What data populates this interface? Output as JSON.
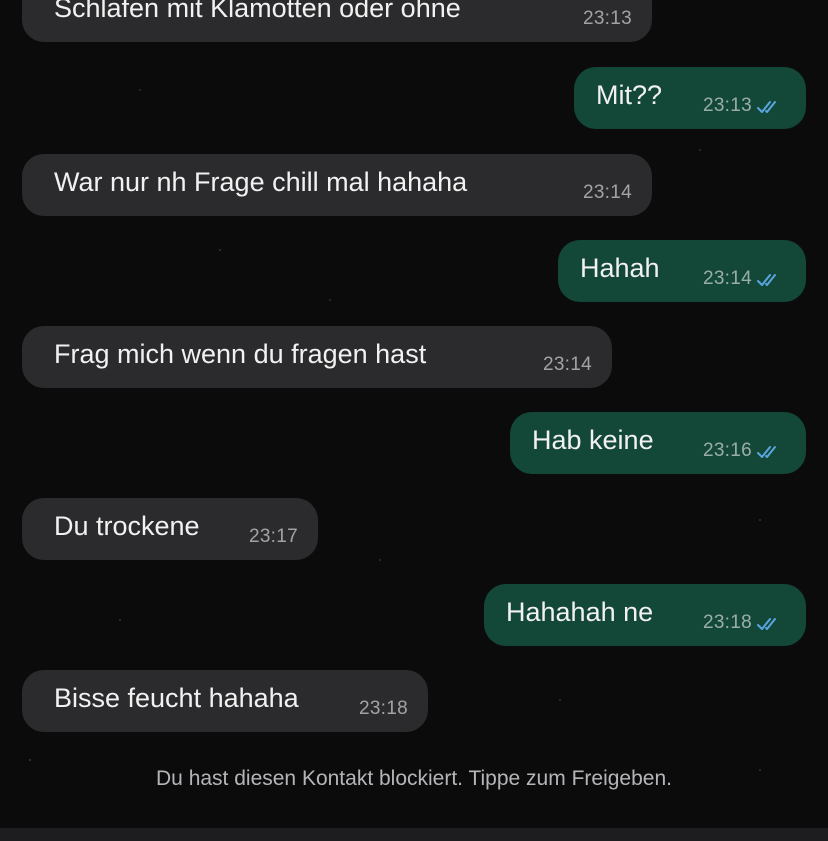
{
  "messages": [
    {
      "direction": "in",
      "text": "Schlafen mit Klamotten oder ohne",
      "time": "23:13"
    },
    {
      "direction": "out",
      "text": "Mit??",
      "time": "23:13",
      "status": "read"
    },
    {
      "direction": "in",
      "text": "War nur nh Frage chill mal hahaha",
      "time": "23:14"
    },
    {
      "direction": "out",
      "text": "Hahah",
      "time": "23:14",
      "status": "read"
    },
    {
      "direction": "in",
      "text": "Frag mich wenn du fragen hast",
      "time": "23:14"
    },
    {
      "direction": "out",
      "text": "Hab keine",
      "time": "23:16",
      "status": "read"
    },
    {
      "direction": "in",
      "text": "Du trockene",
      "time": "23:17"
    },
    {
      "direction": "out",
      "text": "Hahahah ne",
      "time": "23:18",
      "status": "read"
    },
    {
      "direction": "in",
      "text": "Bisse feucht hahaha",
      "time": "23:18"
    }
  ],
  "blocked_banner": "Du hast diesen Kontakt blockiert. Tippe zum Freigeben.",
  "colors": {
    "background": "#0b0b0c",
    "incoming_bubble": "#2b2b2d",
    "outgoing_bubble": "#134738",
    "read_ticks": "#5aa6e0"
  },
  "icons": {
    "read_status": "double-check-icon"
  }
}
